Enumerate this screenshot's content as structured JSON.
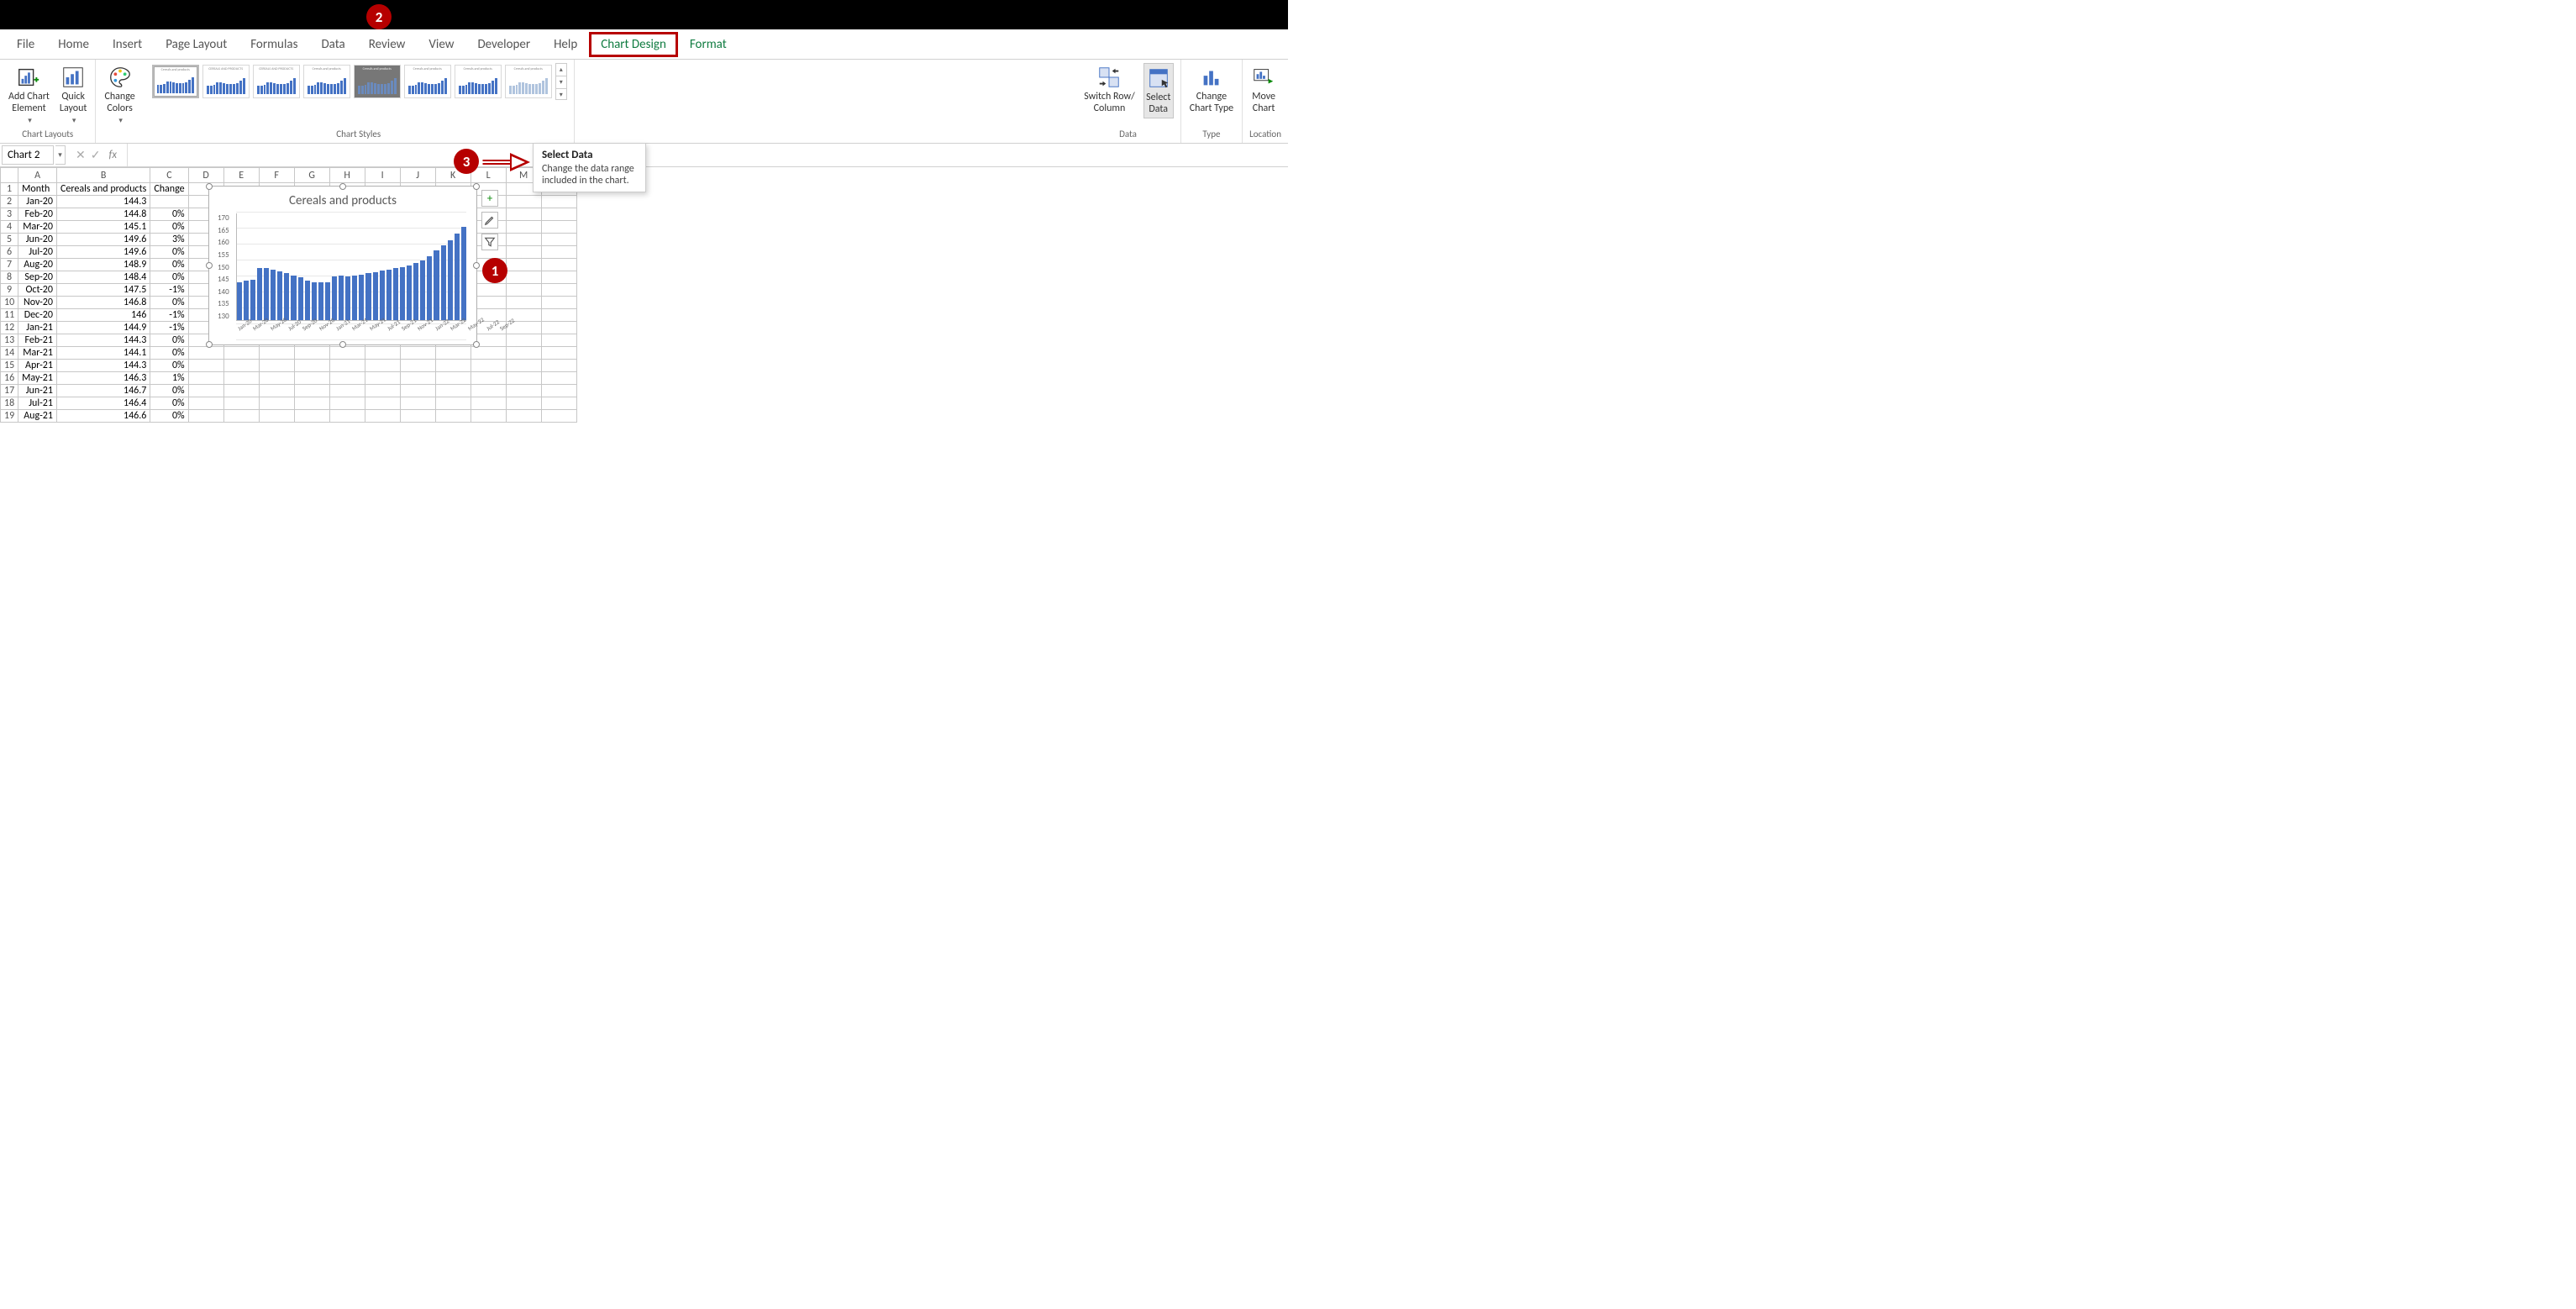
{
  "tabs": {
    "file": "File",
    "home": "Home",
    "insert": "Insert",
    "pageLayout": "Page Layout",
    "formulas": "Formulas",
    "data": "Data",
    "review": "Review",
    "view": "View",
    "developer": "Developer",
    "help": "Help",
    "chartDesign": "Chart Design",
    "format": "Format"
  },
  "ribbon": {
    "chartLayouts": {
      "label": "Chart Layouts",
      "addChartElement": "Add Chart\nElement",
      "quickLayout": "Quick\nLayout"
    },
    "changeColors": "Change\nColors",
    "chartStyles": "Chart Styles",
    "data": {
      "label": "Data",
      "switchRowCol": "Switch Row/\nColumn",
      "selectData": "Select\nData"
    },
    "type": {
      "label": "Type",
      "changeChartType": "Change\nChart Type"
    },
    "location": {
      "label": "Location",
      "moveChart": "Move\nChart"
    }
  },
  "nameBox": "Chart 2",
  "formulaBar": "",
  "columns": [
    "A",
    "B",
    "C",
    "D",
    "E",
    "F",
    "G",
    "H",
    "I",
    "J",
    "K",
    "L",
    "M",
    "N"
  ],
  "headerRow": {
    "A": "Month",
    "B": "Cereals and products",
    "C": "Change"
  },
  "rows": [
    {
      "n": 2,
      "A": "Jan-20",
      "B": "144.3",
      "C": ""
    },
    {
      "n": 3,
      "A": "Feb-20",
      "B": "144.8",
      "C": "0%"
    },
    {
      "n": 4,
      "A": "Mar-20",
      "B": "145.1",
      "C": "0%"
    },
    {
      "n": 5,
      "A": "Jun-20",
      "B": "149.6",
      "C": "3%"
    },
    {
      "n": 6,
      "A": "Jul-20",
      "B": "149.6",
      "C": "0%"
    },
    {
      "n": 7,
      "A": "Aug-20",
      "B": "148.9",
      "C": "0%"
    },
    {
      "n": 8,
      "A": "Sep-20",
      "B": "148.4",
      "C": "0%"
    },
    {
      "n": 9,
      "A": "Oct-20",
      "B": "147.5",
      "C": "-1%"
    },
    {
      "n": 10,
      "A": "Nov-20",
      "B": "146.8",
      "C": "0%"
    },
    {
      "n": 11,
      "A": "Dec-20",
      "B": "146",
      "C": "-1%"
    },
    {
      "n": 12,
      "A": "Jan-21",
      "B": "144.9",
      "C": "-1%"
    },
    {
      "n": 13,
      "A": "Feb-21",
      "B": "144.3",
      "C": "0%"
    },
    {
      "n": 14,
      "A": "Mar-21",
      "B": "144.1",
      "C": "0%"
    },
    {
      "n": 15,
      "A": "Apr-21",
      "B": "144.3",
      "C": "0%"
    },
    {
      "n": 16,
      "A": "May-21",
      "B": "146.3",
      "C": "1%"
    },
    {
      "n": 17,
      "A": "Jun-21",
      "B": "146.7",
      "C": "0%"
    },
    {
      "n": 18,
      "A": "Jul-21",
      "B": "146.4",
      "C": "0%"
    },
    {
      "n": 19,
      "A": "Aug-21",
      "B": "146.6",
      "C": "0%"
    }
  ],
  "tooltip": {
    "title": "Select Data",
    "body": "Change the data range included in the chart."
  },
  "annotations": {
    "one": "1",
    "two": "2",
    "three": "3"
  },
  "chart_data": {
    "type": "bar",
    "title": "Cereals and products",
    "ylabel": "",
    "xlabel": "",
    "ylim": [
      130,
      170
    ],
    "yticks": [
      130,
      135,
      140,
      145,
      150,
      155,
      160,
      165,
      170
    ],
    "categories": [
      "Jan-20",
      "Mar-20",
      "May-20",
      "Jul-20",
      "Sep-20",
      "Nov-20",
      "Jan-21",
      "Mar-21",
      "May-21",
      "Jul-21",
      "Sep-21",
      "Nov-21",
      "Jan-22",
      "Mar-22",
      "May-22",
      "Jul-22",
      "Sep-22"
    ],
    "values": [
      144.3,
      144.8,
      145.1,
      149.6,
      149.6,
      148.9,
      148.4,
      147.5,
      146.8,
      146.0,
      144.9,
      144.3,
      144.1,
      144.3,
      146.3,
      146.7,
      146.4,
      146.6,
      147.0,
      147.5,
      148.0,
      148.5,
      149.0,
      149.5,
      150.0,
      150.5,
      151.5,
      152.5,
      154.0,
      156.0,
      158.0,
      160.0,
      162.5,
      165.0
    ]
  }
}
